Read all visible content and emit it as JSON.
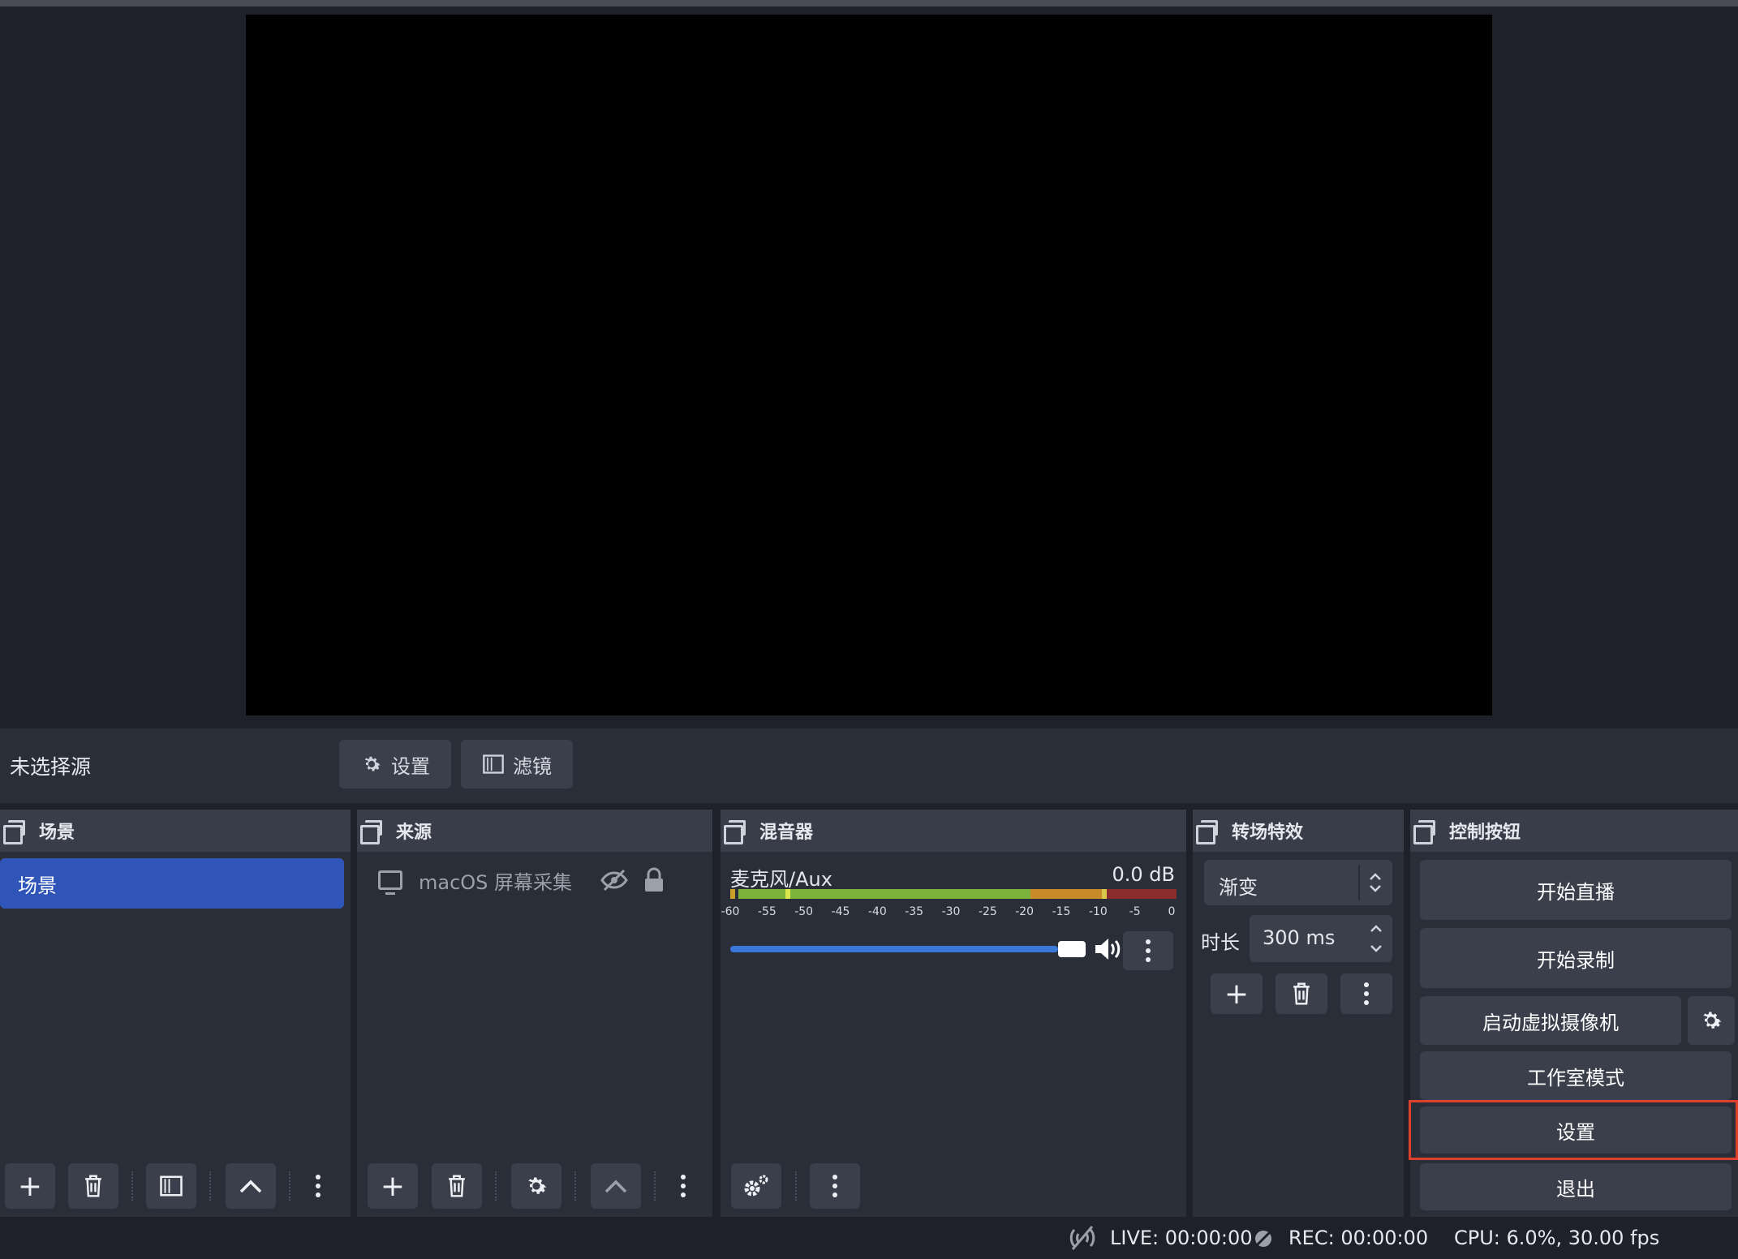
{
  "source_bar": {
    "no_source": "未选择源",
    "properties_label": "设置",
    "filters_label": "滤镜"
  },
  "scenes": {
    "title": "场景",
    "items": [
      {
        "label": "场景",
        "selected": true
      }
    ]
  },
  "sources": {
    "title": "来源",
    "items": [
      {
        "label": "macOS 屏幕采集",
        "visible": false,
        "locked": true
      }
    ]
  },
  "mixer": {
    "title": "混音器",
    "channel": {
      "name": "麦克风/Aux",
      "level": "0.0 dB",
      "volume_fraction": 1.0
    },
    "ticks": [
      "-60",
      "-55",
      "-50",
      "-45",
      "-40",
      "-35",
      "-30",
      "-25",
      "-20",
      "-15",
      "-10",
      "-5",
      "0"
    ]
  },
  "transitions": {
    "title": "转场特效",
    "selected": "渐变",
    "duration_label": "时长",
    "duration_value": "300 ms"
  },
  "controls": {
    "title": "控制按钮",
    "start_streaming": "开始直播",
    "start_recording": "开始录制",
    "start_virtual_camera": "启动虚拟摄像机",
    "studio_mode": "工作室模式",
    "settings": "设置",
    "exit": "退出",
    "highlight_color": "#e0402e"
  },
  "status": {
    "live": "LIVE: 00:00:00",
    "rec": "REC: 00:00:00",
    "cpu": "CPU: 6.0%, 30.00 fps"
  }
}
